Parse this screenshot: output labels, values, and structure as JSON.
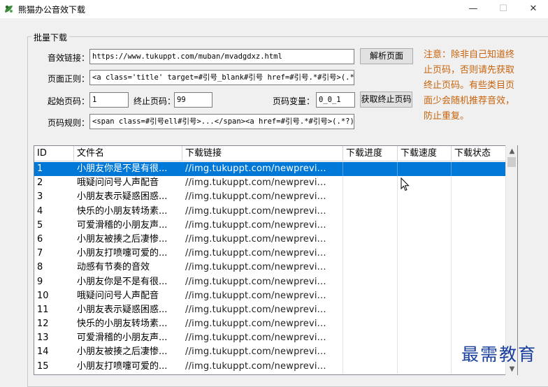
{
  "window": {
    "title": "熊猫办公音效下载",
    "controls": {
      "minimize": "—",
      "maximize": "☐",
      "close": "✕"
    }
  },
  "group": {
    "label": "批量下载"
  },
  "form": {
    "url_label": "音效链接：",
    "url_value": "https://www.tukuppt.com/muban/mvadgdxz.html",
    "regex_label": "页面正则：",
    "regex_value": "<a  class='title' target=#引号_blank#引号 href=#引号.*#引号>(.*?)",
    "start_label": "起始页码：",
    "start_value": "1",
    "end_label": "终止页码：",
    "end_value": "99",
    "var_label": "页码变量：",
    "var_value": "0_0_1",
    "rule_label": "页码规则：",
    "rule_value": "<span class=#引号ell#引号>...</span><a href=#引号.*#引号>(.*?)</a"
  },
  "buttons": {
    "parse": "解析页面",
    "get_end": "获取终止页码"
  },
  "note": "注意：除非自己知道终止页码，否则请先获取终止页码。有些类目页面少会随机推荐音效，防止重复。",
  "table": {
    "columns": [
      "ID",
      "文件名",
      "下载链接",
      "下载进度",
      "下载速度",
      "下载状态"
    ],
    "rows": [
      [
        "1",
        "小朋友你是不是有很...",
        "//img.tukuppt.com/newprevi...",
        "",
        "",
        ""
      ],
      [
        "2",
        "哦疑问问号人声配音",
        "//img.tukuppt.com/newprevi...",
        "",
        "",
        ""
      ],
      [
        "3",
        "小朋友表示疑惑困惑...",
        "//img.tukuppt.com/newprevi...",
        "",
        "",
        ""
      ],
      [
        "4",
        "快乐的小朋友转场素...",
        "//img.tukuppt.com/newprevi...",
        "",
        "",
        ""
      ],
      [
        "5",
        "可爱滑稽的小朋友声...",
        "//img.tukuppt.com/newprevi...",
        "",
        "",
        ""
      ],
      [
        "6",
        "小朋友被揍之后凄惨...",
        "//img.tukuppt.com/newprevi...",
        "",
        "",
        ""
      ],
      [
        "7",
        "小朋友打喷嚏可爱的...",
        "//img.tukuppt.com/newprevi...",
        "",
        "",
        ""
      ],
      [
        "8",
        "动感有节奏的音效",
        "//img.tukuppt.com/newprevi...",
        "",
        "",
        ""
      ],
      [
        "9",
        "小朋友你是不是有很...",
        "//img.tukuppt.com/newprevi...",
        "",
        "",
        ""
      ],
      [
        "10",
        "哦疑问问号人声配音",
        "//img.tukuppt.com/newprevi...",
        "",
        "",
        ""
      ],
      [
        "11",
        "小朋友表示疑惑困惑...",
        "//img.tukuppt.com/newprevi...",
        "",
        "",
        ""
      ],
      [
        "12",
        "快乐的小朋友转场素...",
        "//img.tukuppt.com/newprevi...",
        "",
        "",
        ""
      ],
      [
        "13",
        "可爱滑稽的小朋友声...",
        "//img.tukuppt.com/newprevi...",
        "",
        "",
        ""
      ],
      [
        "14",
        "小朋友被揍之后凄惨...",
        "//img.tukuppt.com/newprevi...",
        "",
        "",
        ""
      ],
      [
        "15",
        "小朋友打喷嚏可爱的...",
        "//img.tukuppt.com/newprevi...",
        "",
        "",
        ""
      ]
    ],
    "selected_row": 0
  },
  "scrollbar": {
    "up": "▲",
    "down": "▼"
  },
  "watermark": "最需教育",
  "colors": {
    "selection": "#0078d7",
    "note": "#c8620a",
    "watermark": "#1a3f9c"
  },
  "icons": {
    "app": "panda-logo-icon",
    "cursor": "mouse-cursor-icon"
  }
}
